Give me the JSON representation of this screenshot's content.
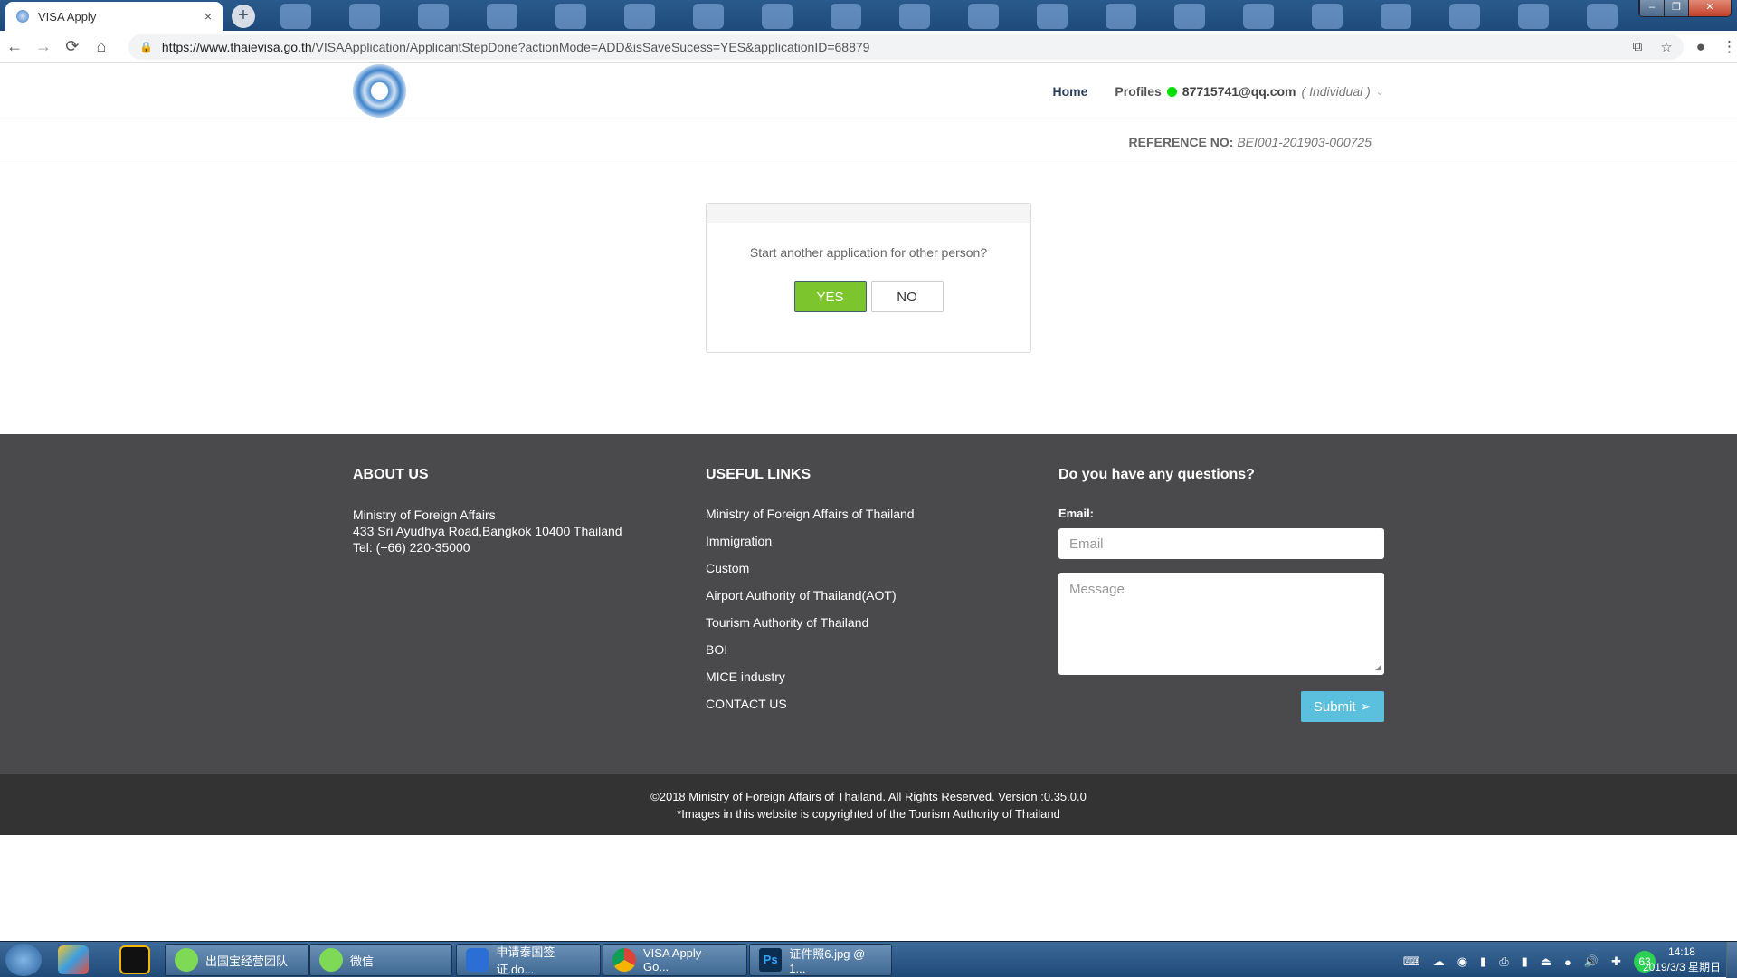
{
  "browser": {
    "tab_title": "VISA Apply",
    "tab_close": "×",
    "new_tab": "+",
    "url_host": "https://www.thaievisa.go.th",
    "url_path": "/VISAApplication/ApplicantStepDone?actionMode=ADD&isSaveSucess=YES&applicationID=68879",
    "nav": {
      "back": "←",
      "forward": "→",
      "reload": "⟳",
      "home": "⌂"
    },
    "window": {
      "minimize": "–",
      "maximize": "❐",
      "close": "✕"
    }
  },
  "header": {
    "home_label": "Home",
    "profiles_label": "Profiles",
    "status_color": "#00e000",
    "user_email": "87715741@qq.com",
    "user_role": "( Individual )",
    "chevron": "⌄"
  },
  "reference": {
    "label": "REFERENCE NO:",
    "value": "BEI001-201903-000725"
  },
  "dialog": {
    "question": "Start another application for other person?",
    "yes_label": "YES",
    "no_label": "NO"
  },
  "footer": {
    "about": {
      "heading": "ABOUT US",
      "lines": [
        "Ministry of Foreign Affairs",
        "433 Sri Ayudhya Road,Bangkok 10400 Thailand",
        "Tel: (+66) 220-35000"
      ]
    },
    "links": {
      "heading": "USEFUL LINKS",
      "items": [
        "Ministry of Foreign Affairs of Thailand",
        "Immigration",
        "Custom",
        "Airport Authority of Thailand(AOT)",
        "Tourism Authority of Thailand",
        "BOI",
        "MICE industry",
        "CONTACT US"
      ]
    },
    "contact": {
      "heading": "Do you have any questions?",
      "email_label": "Email:",
      "email_placeholder": "Email",
      "message_placeholder": "Message",
      "submit_label": "Submit"
    },
    "copyright": "©2018 Ministry of Foreign Affairs of Thailand. All Rights Reserved. Version :0.35.0.0",
    "images_note": "*Images in this website is copyrighted of the Tourism Authority of Thailand"
  },
  "taskbar": {
    "buttons": [
      "出国宝经营团队",
      "微信",
      "申请泰国签证.do...",
      "VISA Apply - Go...",
      "证件照6.jpg @ 1..."
    ],
    "tray_badge": "63",
    "time": "14:18",
    "date": "2019/3/3 星期日"
  }
}
